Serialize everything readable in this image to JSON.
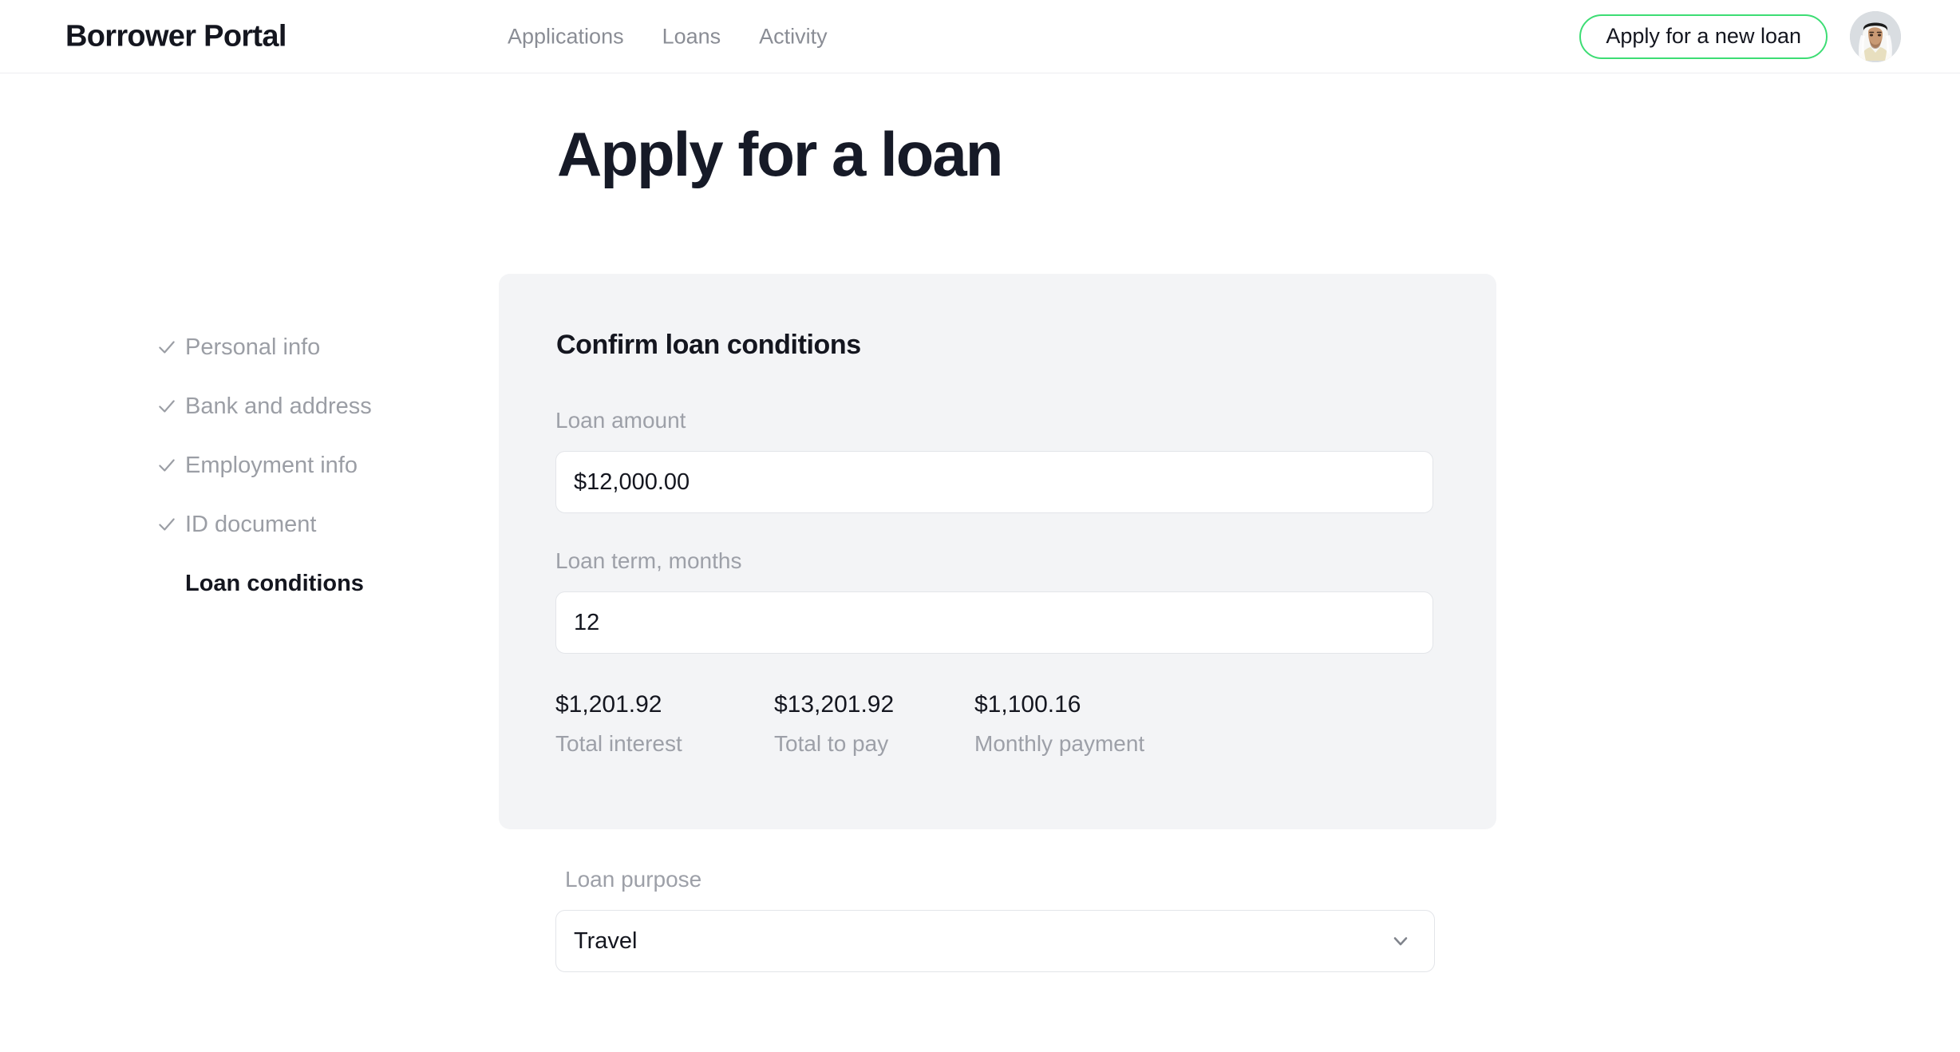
{
  "header": {
    "brand": "Borrower Portal",
    "nav": [
      {
        "label": "Applications"
      },
      {
        "label": "Loans"
      },
      {
        "label": "Activity"
      }
    ],
    "apply_button": "Apply for a new loan",
    "avatar_icon": "user-avatar-icon",
    "accent_color": "#3ddd74",
    "border_color": "#ededf0"
  },
  "page": {
    "title": "Apply for a loan"
  },
  "stepper": {
    "items": [
      {
        "label": "Personal info",
        "completed": true,
        "icon": "check-icon"
      },
      {
        "label": "Bank and address",
        "completed": true,
        "icon": "check-icon"
      },
      {
        "label": "Employment info",
        "completed": true,
        "icon": "check-icon"
      },
      {
        "label": "ID document",
        "completed": true,
        "icon": "check-icon"
      },
      {
        "label": "Loan conditions",
        "completed": false,
        "icon": ""
      }
    ]
  },
  "card": {
    "title": "Confirm loan conditions",
    "background_color": "#f3f4f6",
    "loan_amount": {
      "label": "Loan amount",
      "value": "$12,000.00"
    },
    "loan_term": {
      "label": "Loan term, months",
      "value": "12"
    },
    "summary": [
      {
        "value": "$1,201.92",
        "caption": "Total interest"
      },
      {
        "value": "$13,201.92",
        "caption": "Total to pay"
      },
      {
        "value": "$1,100.16",
        "caption": "Monthly payment"
      }
    ]
  },
  "purpose": {
    "label": "Loan purpose",
    "value": "Travel",
    "chevron_icon": "chevron-down-icon"
  }
}
